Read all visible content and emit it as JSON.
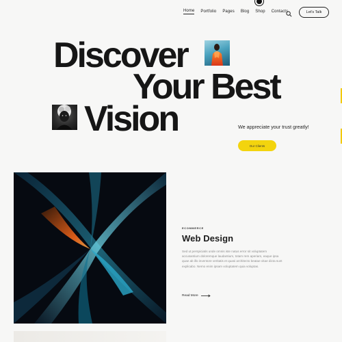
{
  "header": {
    "nav": [
      "Home",
      "Portfolio",
      "Pages",
      "Blog",
      "Shop",
      "Contacts"
    ],
    "active_nav": "Home",
    "search_icon": "search-icon",
    "cta_label": "Let's Talk"
  },
  "hero": {
    "line1": "Discover",
    "line2": "Your Best",
    "line3": "Vision",
    "tagline": "We appreciate your trust greatly!",
    "button_label": "Our Clients"
  },
  "card": {
    "category": "ECOMMERCE",
    "title": "Web Design",
    "description": "Sed ut perspiciatis unde omnis iste natus error sit voluptatem accusantium doloremque laudantium, totam rem aperiam, eaque ipsa quae ab illo inventore veritatis et quasi architecto beatae vitae dicta sunt explicabo. Nemo enim ipsam voluptatem quia voluptas.",
    "read_more": "Read More"
  },
  "colors": {
    "accent": "#f3d40e",
    "background": "#f7f7f6",
    "text": "#141414"
  }
}
